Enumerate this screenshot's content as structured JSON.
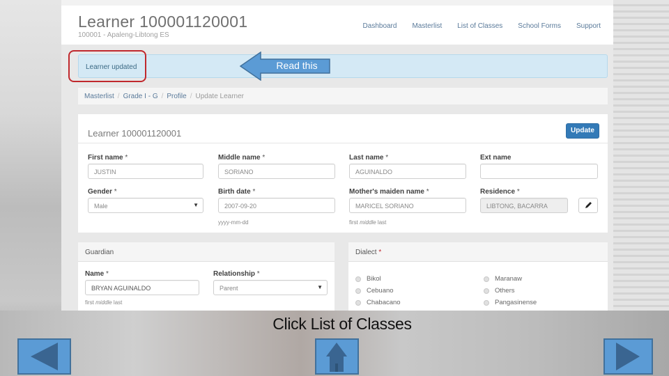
{
  "header": {
    "title": "Learner 100001120001",
    "subtitle": "100001 - Apaleng-Libtong ES"
  },
  "nav": [
    "Dashboard",
    "Masterlist",
    "List of Classes",
    "School Forms",
    "Support"
  ],
  "alert": {
    "message": "Learner updated"
  },
  "callout": {
    "text": "Read this"
  },
  "breadcrumb": {
    "items": [
      "Masterlist",
      "Grade I - G",
      "Profile"
    ],
    "current": "Update Learner"
  },
  "learner_panel": {
    "title": "Learner 100001120001",
    "update_label": "Update",
    "fields": {
      "first_name": {
        "label": "First name",
        "value": "JUSTIN"
      },
      "middle_name": {
        "label": "Middle name",
        "value": "SORIANO"
      },
      "last_name": {
        "label": "Last name",
        "value": "AGUINALDO"
      },
      "ext_name": {
        "label": "Ext name",
        "value": ""
      },
      "gender": {
        "label": "Gender",
        "value": "Male"
      },
      "birth_date": {
        "label": "Birth date",
        "value": "2007-09-20",
        "hint": "yyyy-mm-dd"
      },
      "mother_maiden": {
        "label": "Mother's maiden name",
        "value": "MARICEL SORIANO",
        "hint_pre": "first ",
        "hint_em": "middle",
        "hint_post": " last"
      },
      "residence": {
        "label": "Residence",
        "value": "LIBTONG, BACARRA"
      }
    },
    "required_mark": "*"
  },
  "guardian_panel": {
    "title": "Guardian",
    "name": {
      "label": "Name",
      "value": "BRYAN AGUINALDO",
      "hint_pre": "first ",
      "hint_em": "middle",
      "hint_post": " last"
    },
    "relationship": {
      "label": "Relationship",
      "value": "Parent"
    }
  },
  "dialect_panel": {
    "title": "Dialect",
    "options_left": [
      "Bikol",
      "Cebuano",
      "Chabacano"
    ],
    "options_right": [
      "Maranaw",
      "Others",
      "Pangasinense"
    ]
  },
  "slide": {
    "instruction": "Click List of Classes",
    "colors": {
      "button_fill": "#5b9bd5",
      "button_border": "#41719c",
      "glyph": "#3a6591",
      "highlight": "#c0282d"
    }
  }
}
